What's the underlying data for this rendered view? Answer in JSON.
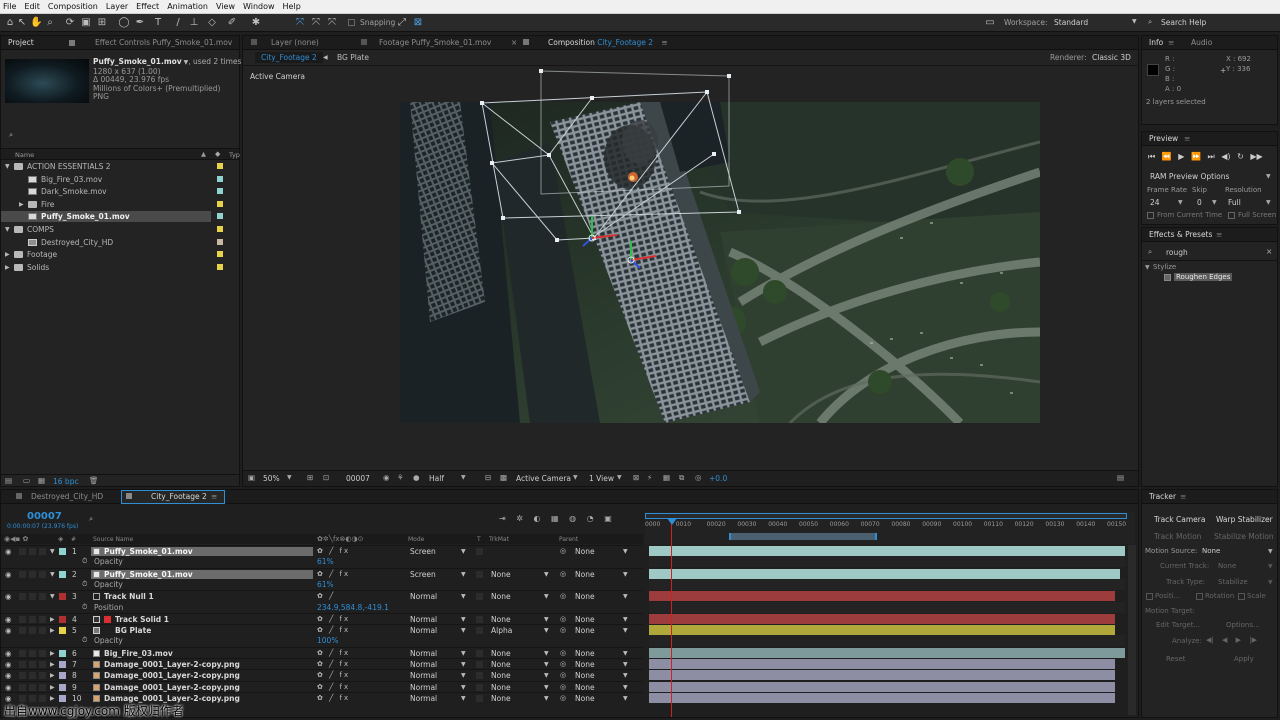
{
  "menu": [
    "File",
    "Edit",
    "Composition",
    "Layer",
    "Effect",
    "Animation",
    "View",
    "Window",
    "Help"
  ],
  "toolbar": {
    "snapping": "Snapping",
    "workspace_label": "Workspace:",
    "workspace_value": "Standard",
    "search_help": "Search Help"
  },
  "project": {
    "tab_project": "Project",
    "tab_effect_controls": "Effect Controls Puffy_Smoke_01.mov",
    "preview": {
      "name": "Puffy_Smoke_01.mov",
      "used": ", used 2 times",
      "line1": "1280 x 637 (1.00)",
      "line2": "Δ 00449, 23.976 fps",
      "line3": "Millions of Colors+ (Premultiplied)",
      "line4": "PNG"
    },
    "col_name": "Name",
    "col_type": "Typ",
    "items": [
      {
        "label": "ACTION ESSENTIALS 2",
        "kind": "folder",
        "open": true,
        "indent": 0,
        "color": "#e8d24a"
      },
      {
        "label": "Big_Fire_03.mov",
        "kind": "file",
        "indent": 1,
        "color": "#8fd3d0"
      },
      {
        "label": "Dark_Smoke.mov",
        "kind": "file",
        "indent": 1,
        "color": "#8fd3d0"
      },
      {
        "label": "Fire",
        "kind": "folder",
        "open": false,
        "indent": 1,
        "color": "#e8d24a"
      },
      {
        "label": "Puffy_Smoke_01.mov",
        "kind": "file",
        "indent": 1,
        "color": "#8fd3d0",
        "selected": true
      },
      {
        "label": "COMPS",
        "kind": "folder",
        "open": true,
        "indent": 0,
        "color": "#e8d24a"
      },
      {
        "label": "Destroyed_City_HD",
        "kind": "comp",
        "indent": 1,
        "color": "#c9b6a3"
      },
      {
        "label": "Footage",
        "kind": "folder",
        "open": false,
        "indent": 0,
        "color": "#e8d24a"
      },
      {
        "label": "Solids",
        "kind": "folder",
        "open": false,
        "indent": 0,
        "color": "#e8d24a"
      }
    ],
    "bpc": "16 bpc"
  },
  "viewer": {
    "tab_layer": "Layer  (none)",
    "tab_footage": "Footage  Puffy_Smoke_01.mov",
    "tab_comp_prefix": "Composition",
    "tab_comp_name": "City_Footage 2",
    "crumb_active": "City_Footage 2",
    "crumb_other": "BG Plate",
    "renderer_label": "Renderer:",
    "renderer_value": "Classic 3D",
    "active_camera": "Active Camera",
    "bottom": {
      "zoom": "50%",
      "timecode": "00007",
      "resolution": "Half",
      "camera": "Active Camera",
      "views": "1 View",
      "exposure": "+0.0"
    }
  },
  "info": {
    "tab_info": "Info",
    "tab_audio": "Audio",
    "r": "R :",
    "g": "G :",
    "b": "B :",
    "a": "A : 0",
    "x": "X : 692",
    "y": "Y : 336",
    "status": "2 layers selected"
  },
  "preview": {
    "title": "Preview",
    "ram": "RAM Preview Options",
    "frame_rate_label": "Frame Rate",
    "skip_label": "Skip",
    "resolution_label": "Resolution",
    "frame_rate": "24",
    "skip": "0",
    "resolution": "Full",
    "from_current": "From Current Time",
    "full_screen": "Full Screen"
  },
  "effects": {
    "title": "Effects & Presets",
    "search": "rough",
    "category": "Stylize",
    "item": "Roughen Edges"
  },
  "tracker": {
    "title": "Tracker",
    "track_camera": "Track Camera",
    "warp_stabilizer": "Warp Stabilizer",
    "track_motion": "Track Motion",
    "stabilize_motion": "Stabilize Motion",
    "motion_source_label": "Motion Source:",
    "motion_source": "None",
    "current_track_label": "Current Track:",
    "current_track": "None",
    "track_type_label": "Track Type:",
    "track_type": "Stabilize",
    "position": "Positi...",
    "rotation": "Rotation",
    "scale": "Scale",
    "motion_target": "Motion Target:",
    "edit_target": "Edit Target...",
    "options": "Options...",
    "analyze": "Analyze:",
    "reset": "Reset",
    "apply": "Apply"
  },
  "timeline": {
    "tab1": "Destroyed_City_HD",
    "tab2": "City_Footage 2",
    "timecode": "00007",
    "timecode_sub": "0:00:00:07 (23.976 fps)",
    "headers": {
      "num": "#",
      "source": "Source Name",
      "mode": "Mode",
      "t": "T",
      "trkmat": "TrkMat",
      "parent": "Parent"
    },
    "ruler": [
      "0000",
      "0010",
      "00020",
      "00030",
      "00040",
      "00050",
      "00060",
      "00070",
      "00080",
      "00090",
      "00100",
      "00110",
      "00120",
      "00130",
      "00140",
      "00150"
    ],
    "rows": [
      {
        "type": "layer",
        "num": "1",
        "name": "Puffy_Smoke_01.mov",
        "label_color": "#8fd3d0",
        "mode": "Screen",
        "trkmat": "",
        "parent": "None",
        "selected": true,
        "bar": "#9ec9c4",
        "bar_start": 0,
        "bar_end": 1,
        "icon": "file"
      },
      {
        "type": "prop",
        "name": "Opacity",
        "value": "61%"
      },
      {
        "type": "layer",
        "num": "2",
        "name": "Puffy_Smoke_01.mov",
        "label_color": "#8fd3d0",
        "mode": "Screen",
        "trkmat": "None",
        "parent": "None",
        "selected": true,
        "bar": "#9ec9c4",
        "bar_start": 0,
        "bar_end": 0.99,
        "icon": "file"
      },
      {
        "type": "prop",
        "name": "Opacity",
        "value": "61%"
      },
      {
        "type": "layer",
        "num": "3",
        "name": "Track Null 1",
        "label_color": "#b03030",
        "mode": "Normal",
        "trkmat": "None",
        "parent": "None",
        "bar": "#9c3c3c",
        "bar_start": 0,
        "bar_end": 0.98,
        "icon": "null"
      },
      {
        "type": "prop",
        "name": "Position",
        "value": "234.9,584.8,-419.1"
      },
      {
        "type": "layer",
        "num": "4",
        "name": "Track Solid 1",
        "label_color": "#b03030",
        "mode": "Normal",
        "trkmat": "None",
        "parent": "None",
        "bar": "#9c3c3c",
        "bar_start": 0,
        "bar_end": 0.98,
        "icon": "solid",
        "swatch": "#d83030"
      },
      {
        "type": "layer",
        "num": "5",
        "name": "BG Plate",
        "label_color": "#e8d24a",
        "mode": "Normal",
        "trkmat": "Alpha",
        "parent": "None",
        "bar": "#b0a83a",
        "bar_start": 0,
        "bar_end": 0.98,
        "icon": "comp"
      },
      {
        "type": "prop",
        "name": "Opacity",
        "value": "100%"
      },
      {
        "type": "layer",
        "num": "6",
        "name": "Big_Fire_03.mov",
        "label_color": "#8fd3d0",
        "mode": "Normal",
        "trkmat": "None",
        "parent": "None",
        "bar": "#7e9a9a",
        "bar_start": 0,
        "bar_end": 1,
        "icon": "file"
      },
      {
        "type": "layer",
        "num": "7",
        "name": "Damage_0001_Layer-2-copy.png",
        "label_color": "#a7a7c9",
        "mode": "Normal",
        "trkmat": "None",
        "parent": "None",
        "bar": "#8d8ea3",
        "bar_start": 0,
        "bar_end": 0.98,
        "icon": "img"
      },
      {
        "type": "layer",
        "num": "8",
        "name": "Damage_0001_Layer-2-copy.png",
        "label_color": "#a7a7c9",
        "mode": "Normal",
        "trkmat": "None",
        "parent": "None",
        "bar": "#8d8ea3",
        "bar_start": 0,
        "bar_end": 0.98,
        "icon": "img"
      },
      {
        "type": "layer",
        "num": "9",
        "name": "Damage_0001_Layer-2-copy.png",
        "label_color": "#a7a7c9",
        "mode": "Normal",
        "trkmat": "None",
        "parent": "None",
        "bar": "#8d8ea3",
        "bar_start": 0,
        "bar_end": 0.98,
        "icon": "img"
      },
      {
        "type": "layer",
        "num": "10",
        "name": "Damage_0001_Layer-2-copy.png",
        "label_color": "#a7a7c9",
        "mode": "Normal",
        "trkmat": "None",
        "parent": "None",
        "bar": "#8d8ea3",
        "bar_start": 0,
        "bar_end": 0.98,
        "icon": "img"
      }
    ]
  },
  "watermark": "出自www.cgjoy.com 版权归作者"
}
